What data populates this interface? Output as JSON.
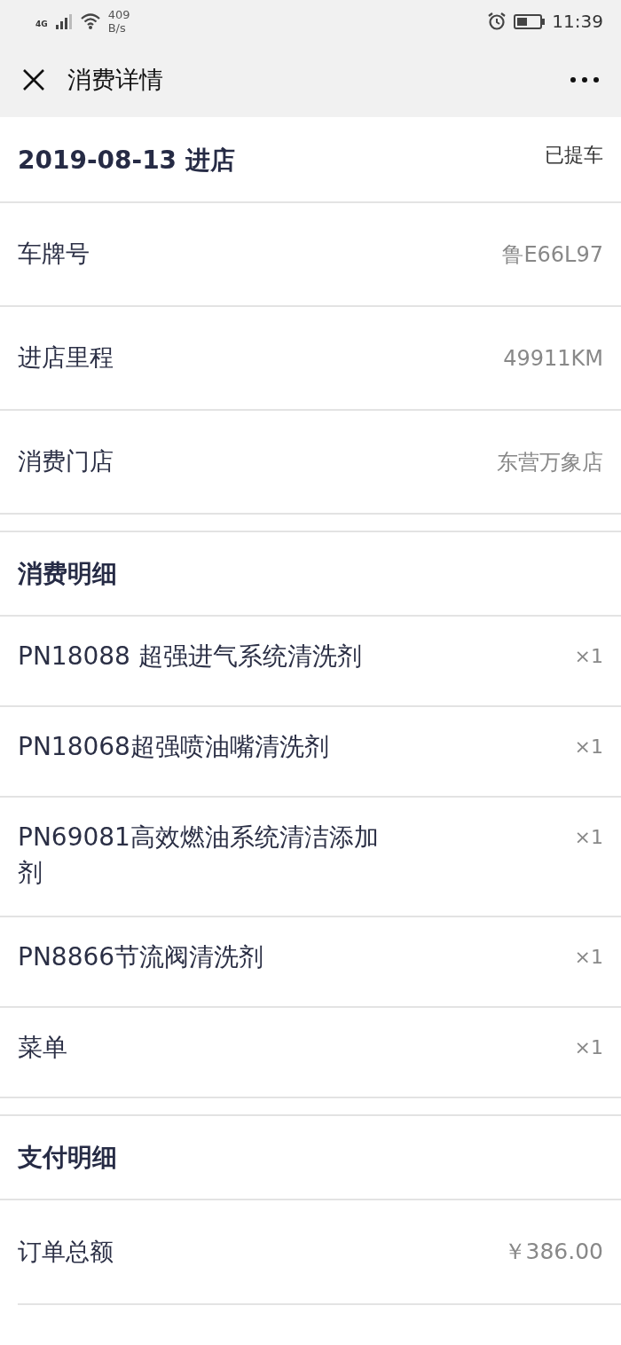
{
  "status_bar": {
    "network": "4G",
    "speed": "409",
    "speed_unit": "B/s",
    "time": "11:39"
  },
  "header": {
    "title": "消费详情"
  },
  "visit": {
    "date": "2019-08-13 进店",
    "status": "已提车"
  },
  "info": [
    {
      "label": "车牌号",
      "value": "鲁E66L97"
    },
    {
      "label": "进店里程",
      "value": "49911KM"
    },
    {
      "label": "消费门店",
      "value": "东营万象店"
    }
  ],
  "consumption": {
    "title": "消费明细",
    "items": [
      {
        "name": "PN18088 超强进气系统清洗剂",
        "qty": "×1"
      },
      {
        "name": "PN18068超强喷油嘴清洗剂",
        "qty": "×1"
      },
      {
        "name": "PN69081高效燃油系统清洁添加剂",
        "qty": "×1"
      },
      {
        "name": "PN8866节流阀清洗剂",
        "qty": "×1"
      },
      {
        "name": "菜单",
        "qty": "×1"
      }
    ]
  },
  "payment": {
    "title": "支付明细",
    "rows": [
      {
        "label": "订单总额",
        "value": "￥386.00"
      }
    ]
  }
}
